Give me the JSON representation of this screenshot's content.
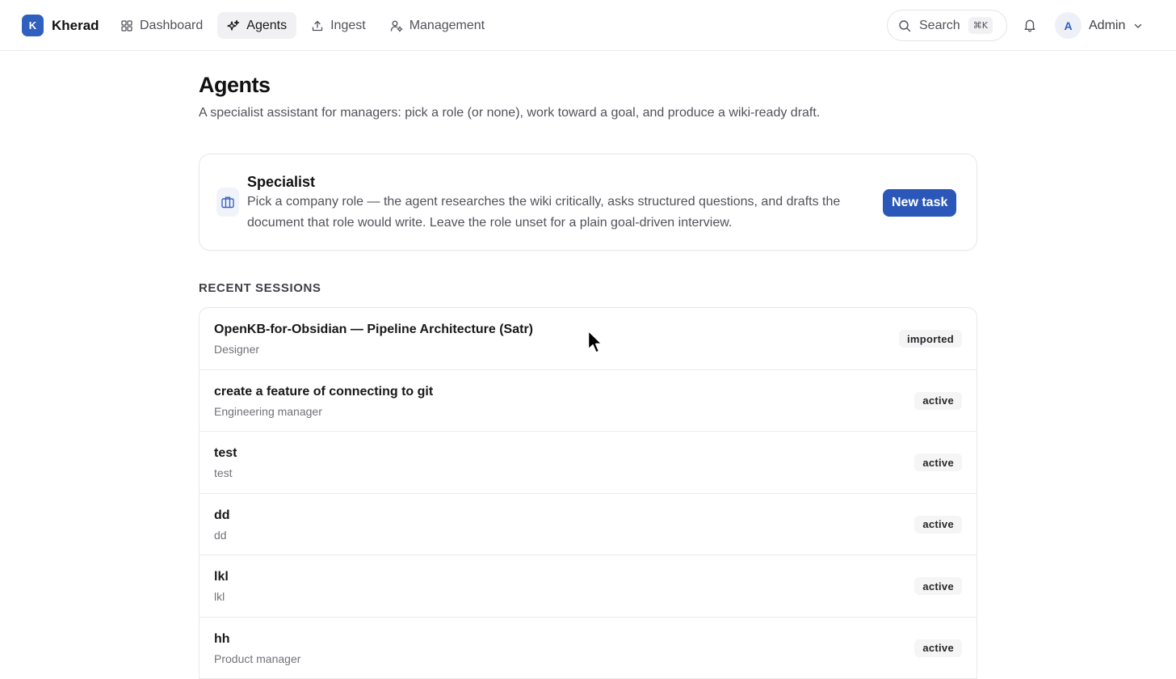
{
  "brand": {
    "logo_letter": "K",
    "name": "Kherad",
    "color": "#2f5fbf"
  },
  "nav": {
    "items": [
      {
        "label": "Dashboard",
        "icon": "grid-icon",
        "active": false
      },
      {
        "label": "Agents",
        "icon": "sparkles-icon",
        "active": true
      },
      {
        "label": "Ingest",
        "icon": "upload-icon",
        "active": false
      },
      {
        "label": "Management",
        "icon": "users-cog-icon",
        "active": false
      }
    ]
  },
  "search": {
    "label": "Search",
    "shortcut": "⌘K"
  },
  "user": {
    "avatar_letter": "A",
    "name": "Admin"
  },
  "page": {
    "title": "Agents",
    "subtitle": "A specialist assistant for managers: pick a role (or none), work toward a goal, and produce a wiki-ready draft."
  },
  "specialist": {
    "title": "Specialist",
    "description": "Pick a company role — the agent researches the wiki critically, asks structured questions, and drafts the document that role would write. Leave the role unset for a plain goal-driven interview.",
    "button_label": "New task",
    "accent": "#2b58b8"
  },
  "recent": {
    "heading": "RECENT SESSIONS",
    "sessions": [
      {
        "title": "OpenKB-for-Obsidian — Pipeline Architecture (Satr)",
        "role": "Designer",
        "status": "imported"
      },
      {
        "title": "create a feature of connecting to git",
        "role": "Engineering manager",
        "status": "active"
      },
      {
        "title": "test",
        "role": "test",
        "status": "active"
      },
      {
        "title": "dd",
        "role": "dd",
        "status": "active"
      },
      {
        "title": "lkl",
        "role": "lkl",
        "status": "active"
      },
      {
        "title": "hh",
        "role": "Product manager",
        "status": "active"
      }
    ]
  }
}
